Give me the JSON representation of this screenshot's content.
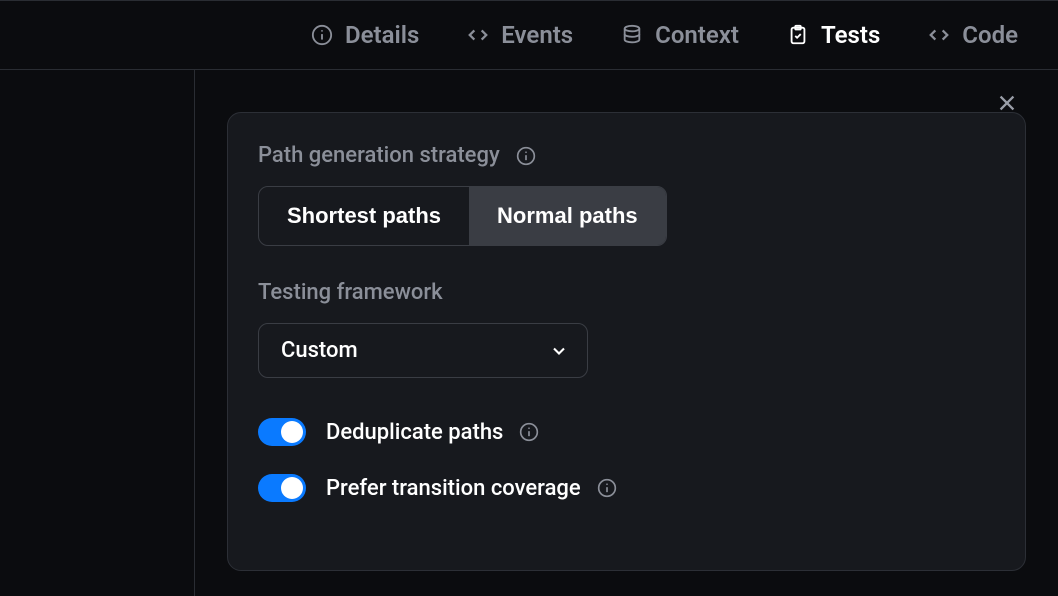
{
  "tabs": {
    "details": "Details",
    "events": "Events",
    "context": "Context",
    "tests": "Tests",
    "code": "Code"
  },
  "panel": {
    "path_strategy_label": "Path generation strategy",
    "seg_shortest": "Shortest paths",
    "seg_normal": "Normal paths",
    "framework_label": "Testing framework",
    "framework_value": "Custom",
    "toggle_dedup": "Deduplicate paths",
    "toggle_prefer": "Prefer transition coverage"
  }
}
